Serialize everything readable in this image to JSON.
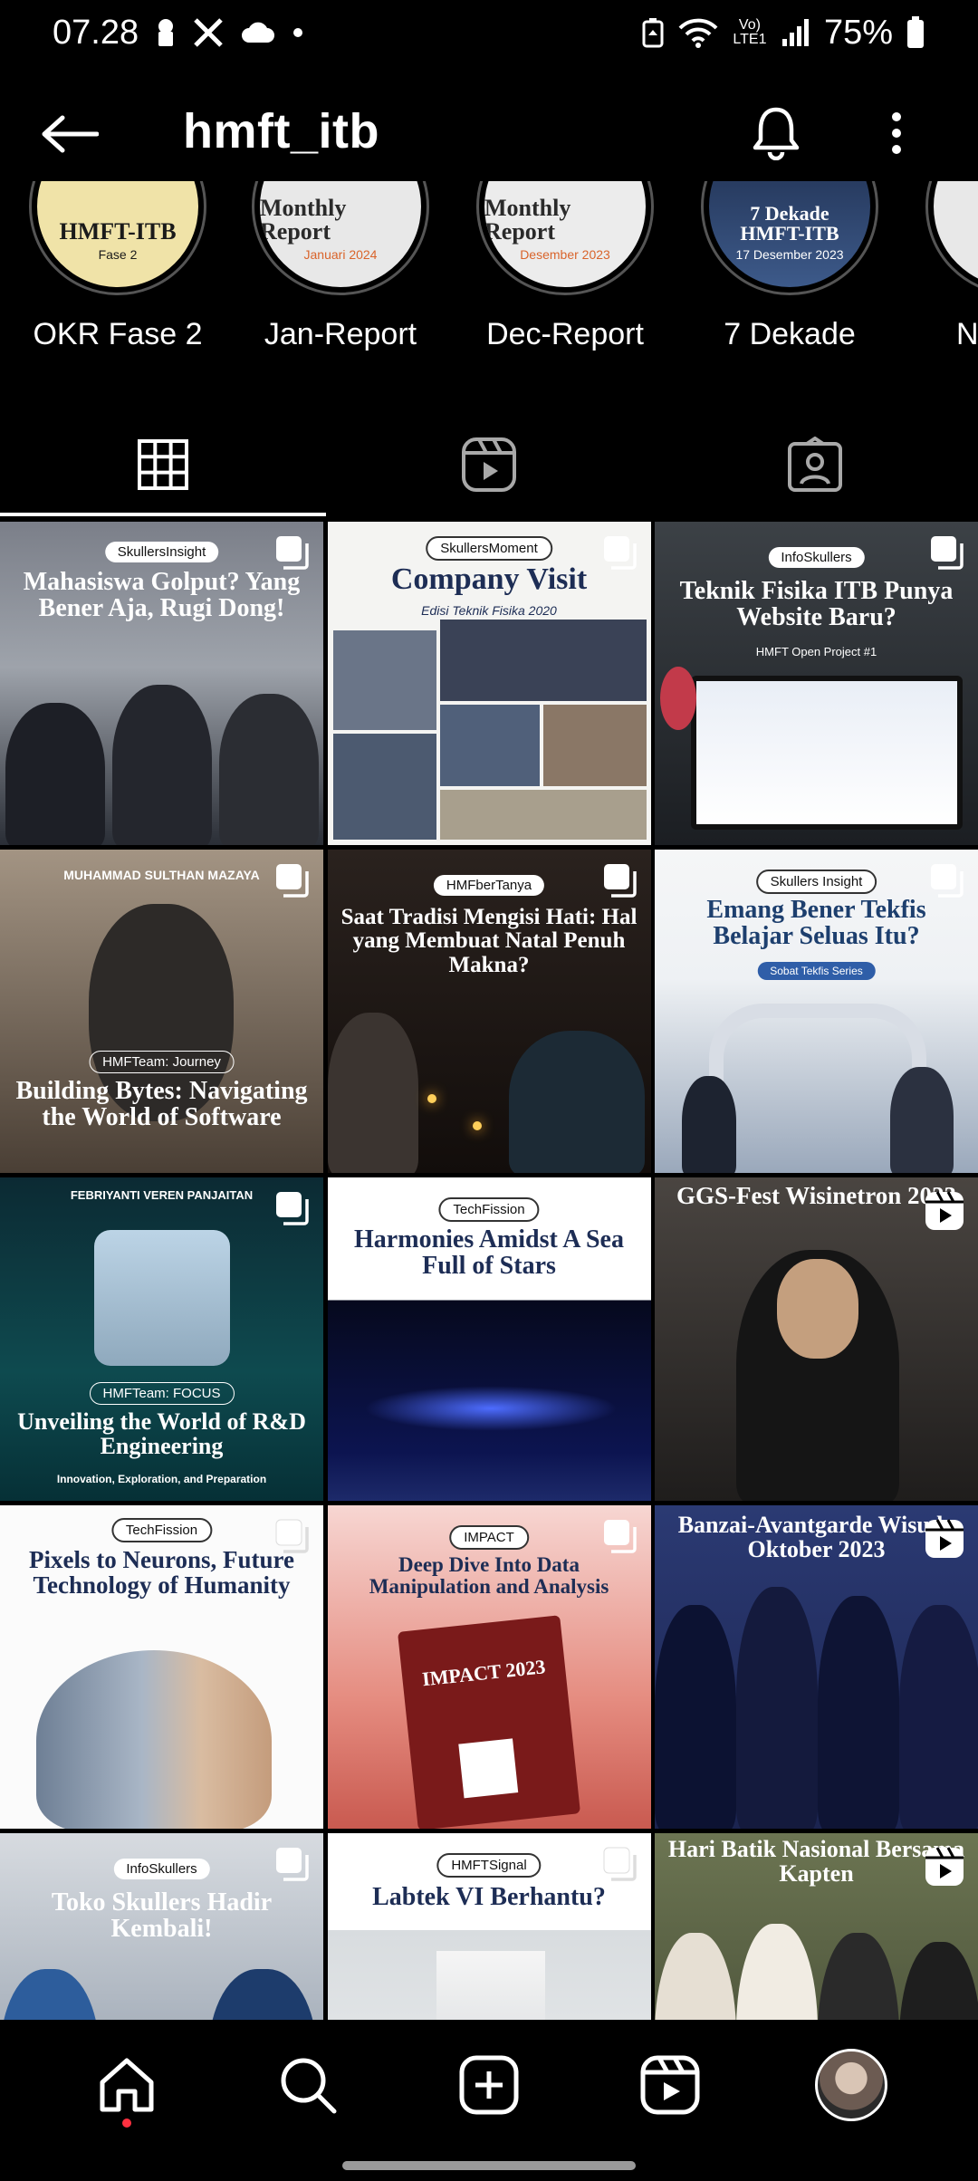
{
  "status_bar": {
    "time": "07.28",
    "battery": "75%",
    "network": "Vo) LTE1"
  },
  "header": {
    "username": "hmft_itb"
  },
  "highlights": [
    {
      "label": "OKR Fase 2",
      "cover_title": "HMFT-ITB",
      "cover_sub": "Fase 2"
    },
    {
      "label": "Jan-Report",
      "cover_title": "Monthly Report",
      "cover_sub": "Januari 2024"
    },
    {
      "label": "Dec-Report",
      "cover_title": "Monthly Report",
      "cover_sub": "Desember 2023"
    },
    {
      "label": "7 Dekade",
      "cover_title": "7 Dekade HMFT-ITB",
      "cover_sub": "17 Desember 2023"
    },
    {
      "label": "Nov",
      "cover_title": "",
      "cover_sub": ""
    }
  ],
  "tabs": [
    {
      "name": "posts-grid",
      "icon": "grid-icon"
    },
    {
      "name": "reels",
      "icon": "reels-icon"
    },
    {
      "name": "tagged",
      "icon": "tagged-icon"
    }
  ],
  "posts": [
    {
      "tag": "SkullersInsight",
      "title": "Mahasiswa Golput? Yang Bener Aja, Rugi Dong!"
    },
    {
      "tag": "SkullersMoment",
      "title": "Company Visit",
      "subtitle": "Edisi Teknik Fisika 2020"
    },
    {
      "tag": "InfoSkullers",
      "title": "Teknik Fisika ITB Punya Website Baru?",
      "subtitle": "HMFT Open Project #1"
    },
    {
      "tag": "HMFTeam: Journey",
      "title": "Building Bytes: Navigating the World of Software",
      "subtitle": "MUHAMMAD SULTHAN MAZAYA"
    },
    {
      "tag": "HMFberTanya",
      "title": "Saat Tradisi Mengisi Hati: Hal yang Membuat Natal Penuh Makna?"
    },
    {
      "tag": "Skullers Insight",
      "title": "Emang Bener Tekfis Belajar Seluas Itu?",
      "subtitle": "Sobat Tekfis Series"
    },
    {
      "tag": "HMFTeam: FOCUS",
      "title": "Unveiling the World of R&D Engineering",
      "subtitle": "FEBRIYANTI VEREN PANJAITAN",
      "footer": "Innovation, Exploration, and Preparation"
    },
    {
      "tag": "TechFission",
      "title": "Harmonies Amidst A Sea Full of Stars"
    },
    {
      "tag": "",
      "title": "GGS-Fest Wisinetron 2023"
    },
    {
      "tag": "TechFission",
      "title": "Pixels to Neurons, Future Technology of Humanity"
    },
    {
      "tag": "IMPACT",
      "title": "Deep Dive Into Data Manipulation and Analysis",
      "subtitle": "IMPACT 2023"
    },
    {
      "tag": "",
      "title": "Banzai-Avantgarde Wisuda Oktober 2023"
    },
    {
      "tag": "InfoSkullers",
      "title": "Toko Skullers Hadir Kembali!"
    },
    {
      "tag": "HMFTSignal",
      "title": "Labtek VI Berhantu?"
    },
    {
      "tag": "",
      "title": "Hari Batik Nasional Bersama Kapten"
    }
  ],
  "colors": {
    "background": "#000000",
    "accent_orange": "#d9642b",
    "notification_dot": "#ff3040"
  }
}
